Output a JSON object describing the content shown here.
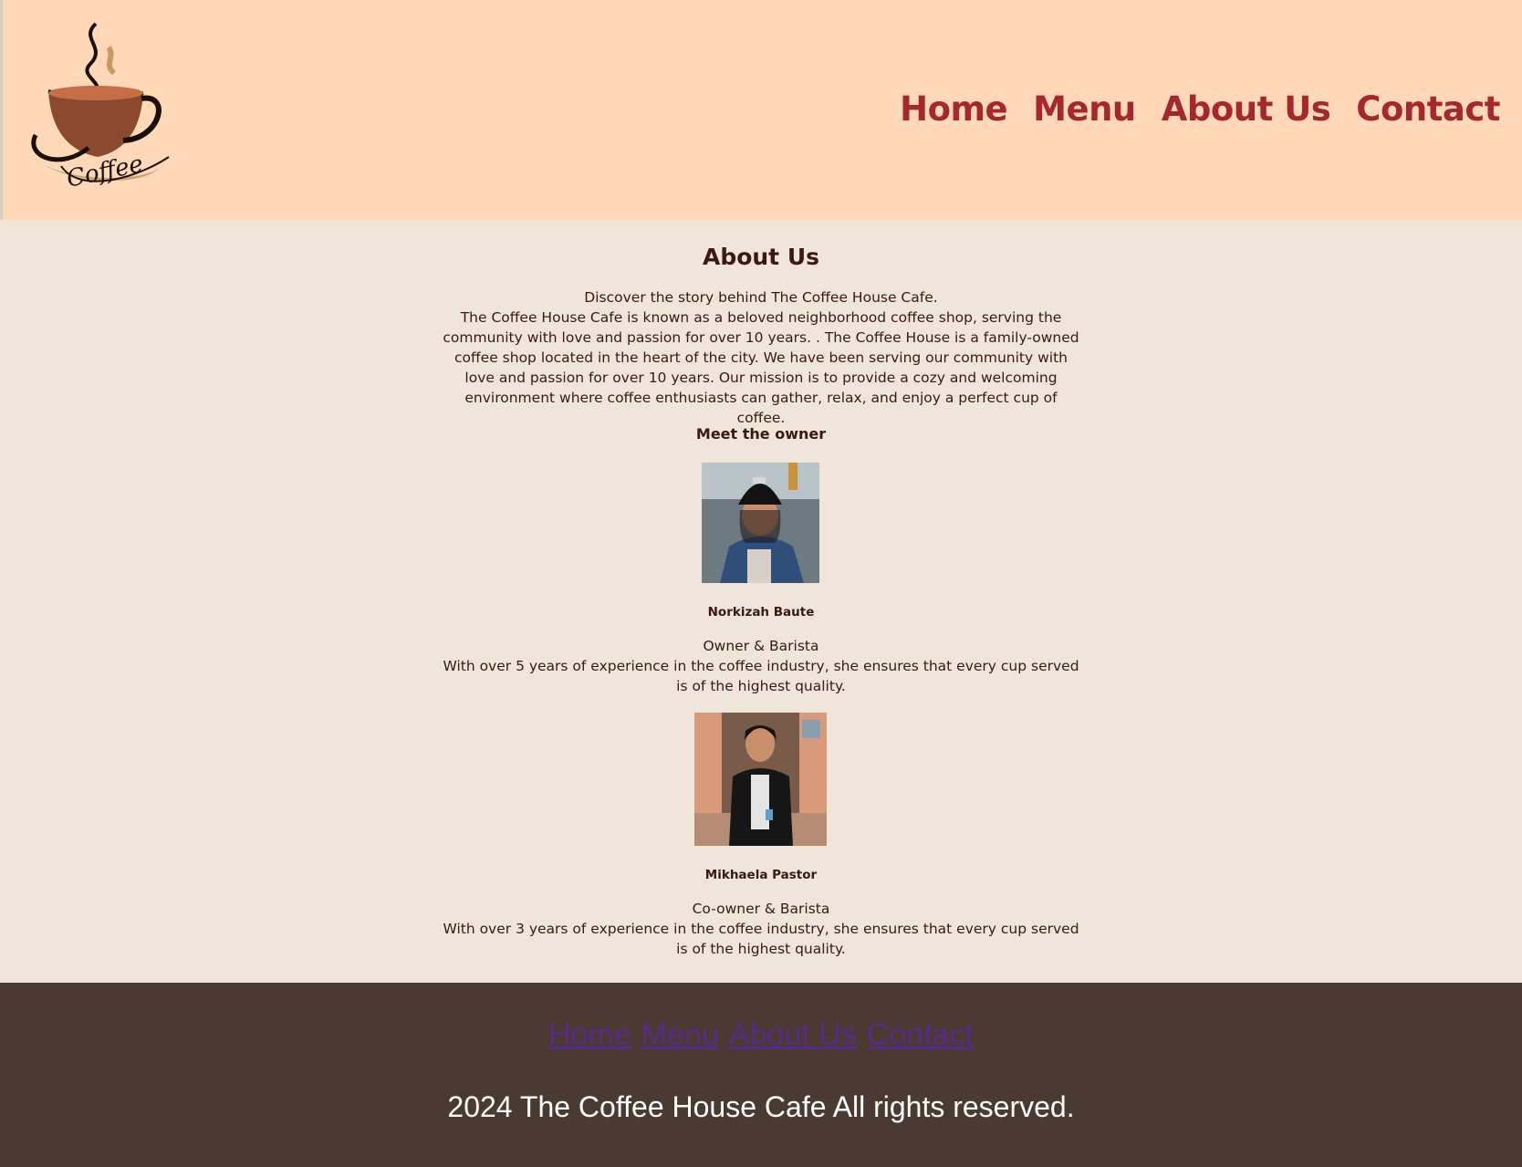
{
  "header": {
    "logo_text": "Coffee",
    "nav": [
      "Home",
      "Menu",
      "About Us",
      "Contact"
    ]
  },
  "main": {
    "title": "About Us",
    "intro_lines": [
      "Discover the story behind The Coffee House Cafe.",
      "The Coffee House Cafe is known as a beloved neighborhood coffee shop, serving the community with love and passion for over 10 years. . The Coffee House is a family-owned coffee shop located in the heart of the city. We have been serving our community with love and passion for over 10 years. Our mission is to provide a cozy and welcoming environment where coffee enthusiasts can gather, relax, and enjoy a perfect cup of coffee."
    ],
    "owner_heading": "Meet the owner",
    "owners": [
      {
        "name": "Norkizah Baute",
        "role": "Owner & Barista",
        "bio": "With over 5 years of experience in the coffee industry, she ensures that every cup served is of the highest quality."
      },
      {
        "name": "Mikhaela Pastor",
        "role": "Co-owner & Barista",
        "bio": "With over 3 years of experience in the coffee industry, she ensures that every cup served is of the highest quality."
      }
    ]
  },
  "footer": {
    "nav": [
      "Home",
      "Menu",
      "About Us",
      "Contact"
    ],
    "copyright": "2024 The Coffee House Cafe All rights reserved."
  },
  "colors": {
    "header_bg": "#ffd9b7",
    "nav_link": "#a4282d",
    "body_bg": "#efe5d8",
    "text": "#3a1a10",
    "footer_bg": "#4b3a31",
    "footer_link": "#5a2a8a"
  }
}
